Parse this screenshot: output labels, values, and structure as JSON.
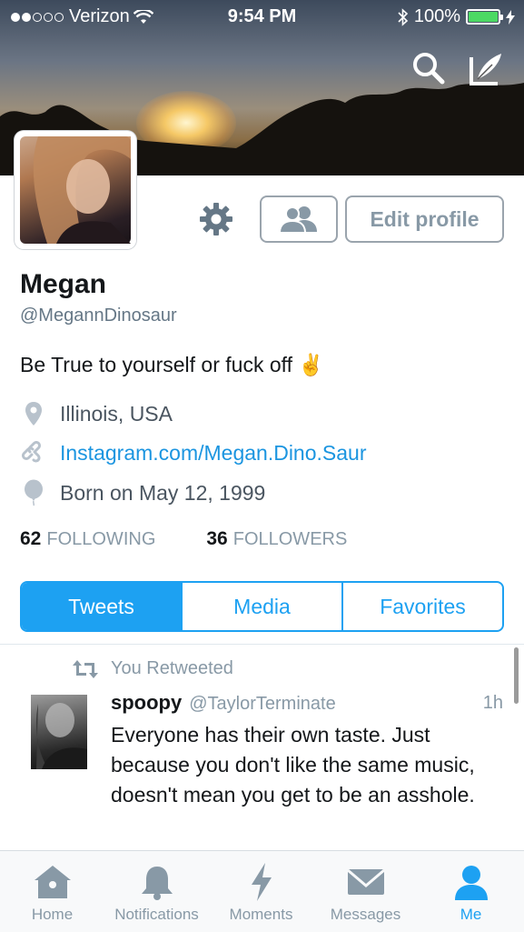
{
  "status_bar": {
    "carrier": "Verizon",
    "time": "9:54 PM",
    "battery": "100%"
  },
  "colors": {
    "accent": "#1da1f2",
    "muted": "#8899a6",
    "battery_green": "#4cd964"
  },
  "header_icons": [
    "search-icon",
    "compose-icon"
  ],
  "profile": {
    "name": "Megan",
    "handle": "@MegannDinosaur",
    "bio": "Be True to yourself or fuck off ✌️",
    "location": "Illinois, USA",
    "website": "Instagram.com/Megan.Dino.Saur",
    "birthday": "Born on May 12, 1999",
    "following_count": "62",
    "following_label": "FOLLOWING",
    "followers_count": "36",
    "followers_label": "FOLLOWERS"
  },
  "actions": {
    "edit_profile": "Edit profile"
  },
  "tabs": [
    {
      "label": "Tweets",
      "active": true
    },
    {
      "label": "Media",
      "active": false
    },
    {
      "label": "Favorites",
      "active": false
    }
  ],
  "tweet": {
    "retweet_label": "You Retweeted",
    "author_name": "spoopy",
    "author_handle": "@TaylorTerminate",
    "time": "1h",
    "text": "Everyone has their own taste. Just because you don't like the same music, doesn't mean you get to be an asshole."
  },
  "tab_bar": [
    {
      "label": "Home",
      "icon": "home-icon",
      "active": false
    },
    {
      "label": "Notifications",
      "icon": "bell-icon",
      "active": false
    },
    {
      "label": "Moments",
      "icon": "lightning-icon",
      "active": false
    },
    {
      "label": "Messages",
      "icon": "envelope-icon",
      "active": false
    },
    {
      "label": "Me",
      "icon": "person-icon",
      "active": true
    }
  ]
}
